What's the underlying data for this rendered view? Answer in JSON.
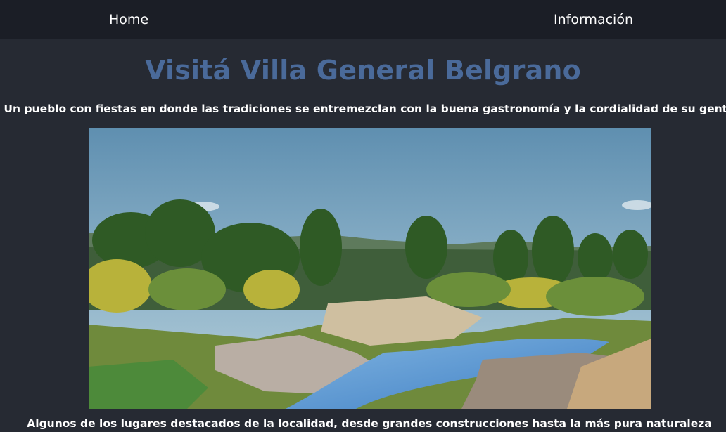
{
  "nav": {
    "home_label": "Home",
    "info_label": "Información"
  },
  "main": {
    "title": "Visitá Villa General Belgrano",
    "subtitle": "Un pueblo con fiestas en donde las tradiciones se entremezclan con la buena gastronomía y la cordialidad de su gente",
    "caption": "Algunos de los lugares destacados de la localidad, desde grandes construcciones hasta la más pura naturaleza"
  },
  "colors": {
    "background": "#262a33",
    "navbar": "#1b1e26",
    "title": "#4a6a9a",
    "text": "#ffffff"
  }
}
